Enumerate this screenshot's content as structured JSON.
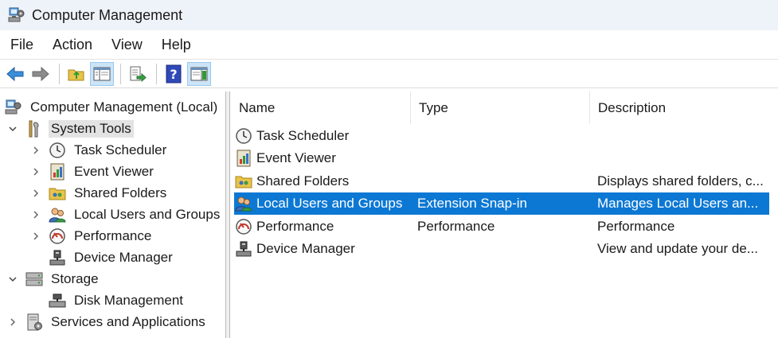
{
  "window": {
    "title": "Computer Management"
  },
  "menu": [
    "File",
    "Action",
    "View",
    "Help"
  ],
  "toolbar": {
    "buttons": [
      {
        "icon": "back-arrow-icon"
      },
      {
        "icon": "forward-arrow-icon"
      },
      {
        "icon": "up-folder-icon"
      },
      {
        "icon": "show-hide-console-tree-icon",
        "pressed": true
      },
      {
        "icon": "export-list-icon"
      },
      {
        "icon": "help-icon"
      },
      {
        "icon": "show-hide-action-pane-icon",
        "pressed": true
      }
    ]
  },
  "tree": {
    "root": "Computer Management (Local)",
    "system_tools": "System Tools",
    "task_scheduler": "Task Scheduler",
    "event_viewer": "Event Viewer",
    "shared_folders": "Shared Folders",
    "local_users": "Local Users and Groups",
    "performance": "Performance",
    "device_manager": "Device Manager",
    "storage": "Storage",
    "disk_management": "Disk Management",
    "services": "Services and Applications"
  },
  "list": {
    "columns": {
      "name": "Name",
      "type": "Type",
      "description": "Description"
    },
    "rows": [
      {
        "name": "Task Scheduler",
        "type": "",
        "description": ""
      },
      {
        "name": "Event Viewer",
        "type": "",
        "description": ""
      },
      {
        "name": "Shared Folders",
        "type": "",
        "description": "Displays shared folders, c..."
      },
      {
        "name": "Local Users and Groups",
        "type": "Extension Snap-in",
        "description": "Manages Local Users an..."
      },
      {
        "name": "Performance",
        "type": "Performance",
        "description": "Performance"
      },
      {
        "name": "Device Manager",
        "type": "",
        "description": "View and update your de..."
      }
    ]
  },
  "colors": {
    "selection": "#0c78d4",
    "tree_selection": "#e3e3e3",
    "titlebar": "#eef2f9"
  }
}
